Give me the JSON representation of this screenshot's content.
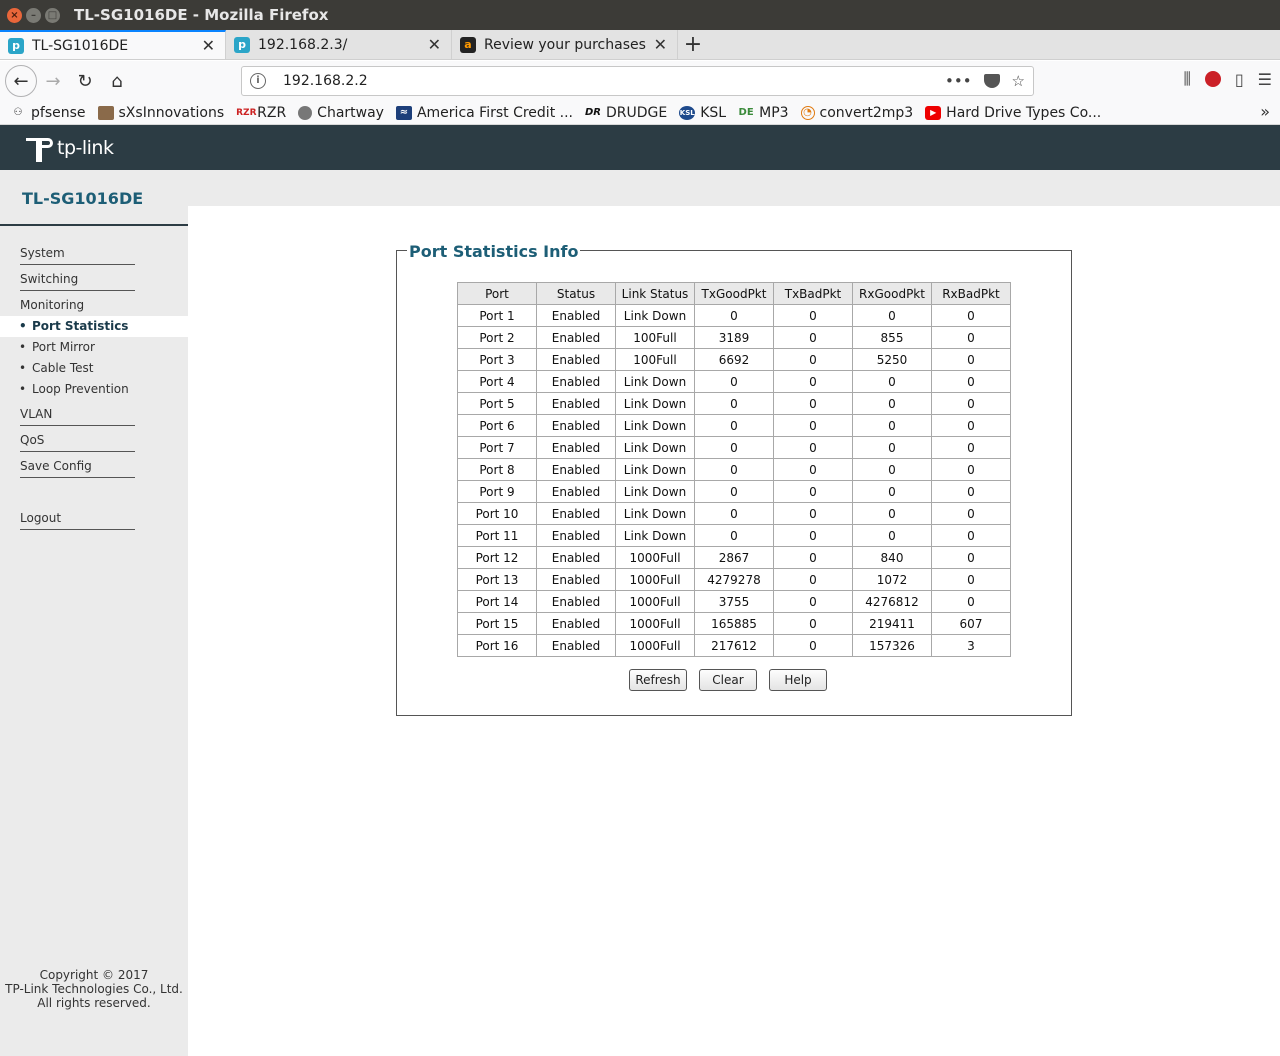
{
  "window": {
    "title": "TL-SG1016DE - Mozilla Firefox"
  },
  "tabs": [
    {
      "label": "TL-SG1016DE",
      "active": true
    },
    {
      "label": "192.168.2.3/",
      "active": false
    },
    {
      "label": "Review your purchases",
      "active": false
    }
  ],
  "navbar": {
    "url": "192.168.2.2"
  },
  "bookmarks": [
    {
      "label": "pfsense",
      "icon": "pfsense-icon"
    },
    {
      "label": "sXsInnovations",
      "icon": "sxs-icon"
    },
    {
      "label": "RZR",
      "icon": "rzr-icon"
    },
    {
      "label": "Chartway",
      "icon": "globe-icon"
    },
    {
      "label": "America First Credit ...",
      "icon": "afcu-icon"
    },
    {
      "label": "DRUDGE",
      "icon": "drudge-icon"
    },
    {
      "label": "KSL",
      "icon": "ksl-icon"
    },
    {
      "label": "MP3",
      "icon": "mp3-icon"
    },
    {
      "label": "convert2mp3",
      "icon": "convert2mp3-icon"
    },
    {
      "label": "Hard Drive Types Co...",
      "icon": "youtube-icon"
    }
  ],
  "brand": {
    "logo_text": "tp-link"
  },
  "sidebar": {
    "model": "TL-SG1016DE",
    "menu": {
      "system": "System",
      "switching": "Switching",
      "monitoring": "Monitoring",
      "port_statistics": "Port Statistics",
      "port_mirror": "Port Mirror",
      "cable_test": "Cable Test",
      "loop_prevention": "Loop Prevention",
      "vlan": "VLAN",
      "qos": "QoS",
      "save_config": "Save Config",
      "logout": "Logout"
    },
    "copyright": {
      "line1": "Copyright © 2017",
      "line2": "TP-Link Technologies Co., Ltd.",
      "line3": "All rights reserved."
    }
  },
  "panel": {
    "title": "Port Statistics Info",
    "columns": [
      "Port",
      "Status",
      "Link Status",
      "TxGoodPkt",
      "TxBadPkt",
      "RxGoodPkt",
      "RxBadPkt"
    ],
    "rows": [
      [
        "Port 1",
        "Enabled",
        "Link Down",
        "0",
        "0",
        "0",
        "0"
      ],
      [
        "Port 2",
        "Enabled",
        "100Full",
        "3189",
        "0",
        "855",
        "0"
      ],
      [
        "Port 3",
        "Enabled",
        "100Full",
        "6692",
        "0",
        "5250",
        "0"
      ],
      [
        "Port 4",
        "Enabled",
        "Link Down",
        "0",
        "0",
        "0",
        "0"
      ],
      [
        "Port 5",
        "Enabled",
        "Link Down",
        "0",
        "0",
        "0",
        "0"
      ],
      [
        "Port 6",
        "Enabled",
        "Link Down",
        "0",
        "0",
        "0",
        "0"
      ],
      [
        "Port 7",
        "Enabled",
        "Link Down",
        "0",
        "0",
        "0",
        "0"
      ],
      [
        "Port 8",
        "Enabled",
        "Link Down",
        "0",
        "0",
        "0",
        "0"
      ],
      [
        "Port 9",
        "Enabled",
        "Link Down",
        "0",
        "0",
        "0",
        "0"
      ],
      [
        "Port 10",
        "Enabled",
        "Link Down",
        "0",
        "0",
        "0",
        "0"
      ],
      [
        "Port 11",
        "Enabled",
        "Link Down",
        "0",
        "0",
        "0",
        "0"
      ],
      [
        "Port 12",
        "Enabled",
        "1000Full",
        "2867",
        "0",
        "840",
        "0"
      ],
      [
        "Port 13",
        "Enabled",
        "1000Full",
        "4279278",
        "0",
        "1072",
        "0"
      ],
      [
        "Port 14",
        "Enabled",
        "1000Full",
        "3755",
        "0",
        "4276812",
        "0"
      ],
      [
        "Port 15",
        "Enabled",
        "1000Full",
        "165885",
        "0",
        "219411",
        "607"
      ],
      [
        "Port 16",
        "Enabled",
        "1000Full",
        "217612",
        "0",
        "157326",
        "3"
      ]
    ],
    "buttons": {
      "refresh": "Refresh",
      "clear": "Clear",
      "help": "Help"
    }
  },
  "colors": {
    "header_bg": "#2c3c44",
    "title_blue": "#1d5e76",
    "sidebar_bg": "#ebebeb"
  }
}
